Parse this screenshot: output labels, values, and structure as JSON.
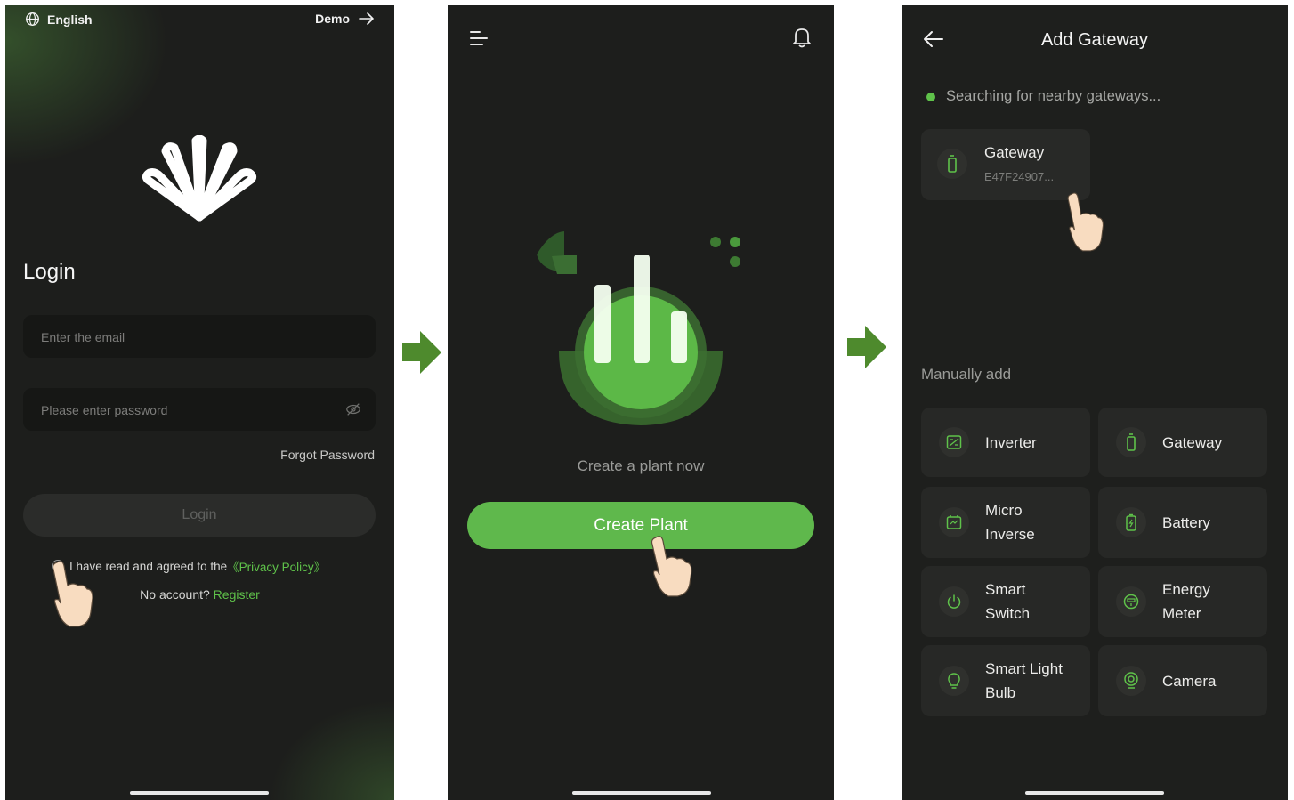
{
  "colors": {
    "accent_green": "#5fb84c",
    "link_green": "#5fc24a",
    "screen_bg": "#1d1e1c",
    "flow_arrow": "#4e8a2d"
  },
  "screen1": {
    "language": "English",
    "demo": "Demo",
    "title": "Login",
    "email_placeholder": "Enter the email",
    "password_placeholder": "Please enter password",
    "forgot": "Forgot Password",
    "login_button": "Login",
    "agree_text": "I have read and agreed to the ",
    "privacy_link": "《Privacy Policy》",
    "no_account": "No account? ",
    "register": "Register",
    "icons": [
      "globe-icon",
      "arrow-right-icon",
      "eye-off-icon",
      "shell-logo-icon",
      "tap-hand-icon"
    ]
  },
  "screen2": {
    "plant_text": "Create a plant now",
    "create_button": "Create Plant",
    "icons": [
      "menu-icon",
      "bell-icon",
      "chart-illustration",
      "tap-hand-icon"
    ]
  },
  "screen3": {
    "title": "Add Gateway",
    "searching": "Searching for nearby gateways...",
    "found_gateway": {
      "name": "Gateway",
      "id": "E47F24907..."
    },
    "manually_add": "Manually add",
    "devices": [
      {
        "label": "Inverter",
        "icon": "inverter-icon"
      },
      {
        "label": "Gateway",
        "icon": "gateway-icon"
      },
      {
        "label": "Micro\nInverse",
        "icon": "micro-inverter-icon"
      },
      {
        "label": "Battery",
        "icon": "battery-icon"
      },
      {
        "label": "Smart\nSwitch",
        "icon": "power-switch-icon"
      },
      {
        "label": "Energy\nMeter",
        "icon": "meter-icon"
      },
      {
        "label": "Smart Light\nBulb",
        "icon": "bulb-icon"
      },
      {
        "label": "Camera",
        "icon": "camera-icon"
      }
    ],
    "icons": [
      "back-arrow-icon",
      "tap-hand-icon"
    ]
  }
}
